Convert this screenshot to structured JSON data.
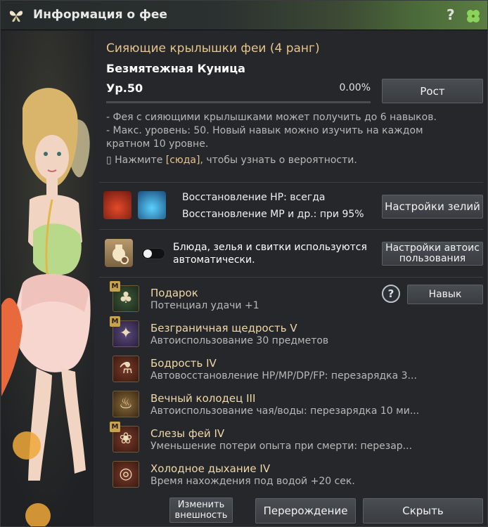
{
  "window": {
    "title": "Информация о фее",
    "help_glyph": "?"
  },
  "fairy": {
    "name": "Сияющие крылышки феи (4 ранг)",
    "subtitle": "Безмятежная Куница",
    "level": "Ур.50",
    "exp_percent_text": "0.00%",
    "exp_fraction": 0.0
  },
  "buttons": {
    "growth": "Рост",
    "potion_settings": "Настройки зелий",
    "auto_settings": "Настройки автоиспользования",
    "skill": "Навык",
    "change_look": "Изменить внешность",
    "rebirth": "Перерождение",
    "hide": "Скрыть"
  },
  "description": {
    "line1": "- Фея с сияющими крылышками может получить до 6 навыков.",
    "line2": "- Макс. уровень: 50. Новый навык можно изучить на каждом кратном 10 уровне.",
    "line3_prefix": "▯ Нажмите ",
    "line3_link": "[сюда]",
    "line3_suffix": ", чтобы узнать о вероятности."
  },
  "potions": {
    "hp": "Восстановление HP: всегда",
    "mp": "Восстановление MP и др.: при 95%"
  },
  "auto_use": {
    "text": "Блюда, зелья и свитки используются автоматически.",
    "enabled": false
  },
  "skills": [
    {
      "name": "Подарок",
      "desc": "Потенциал удачи +1",
      "badge": "M",
      "icon": "clover-icon"
    },
    {
      "name": "Безграничная щедрость V",
      "desc": "Автоиспользование 30 предметов",
      "badge": "M",
      "icon": "fairy-icon"
    },
    {
      "name": "Бодрость IV",
      "desc": "Автовосстановление HP/MP/DP/FP: перезарядка 3...",
      "badge": "",
      "icon": "potions-icon"
    },
    {
      "name": "Вечный колодец III",
      "desc": "Автоиспользование чая/воды: перезарядка 10 ми...",
      "badge": "",
      "icon": "well-icon"
    },
    {
      "name": "Слезы фей IV",
      "desc": "Уменьшение потери опыта при смерти: перезар...",
      "badge": "M",
      "icon": "tears-icon"
    },
    {
      "name": "Холодное дыхание IV",
      "desc": "Время нахождения под водой +20 сек.",
      "badge": "",
      "icon": "breath-icon"
    }
  ],
  "colors": {
    "accent_gold": "#e6c58c",
    "title_green": "#5a7d42"
  }
}
